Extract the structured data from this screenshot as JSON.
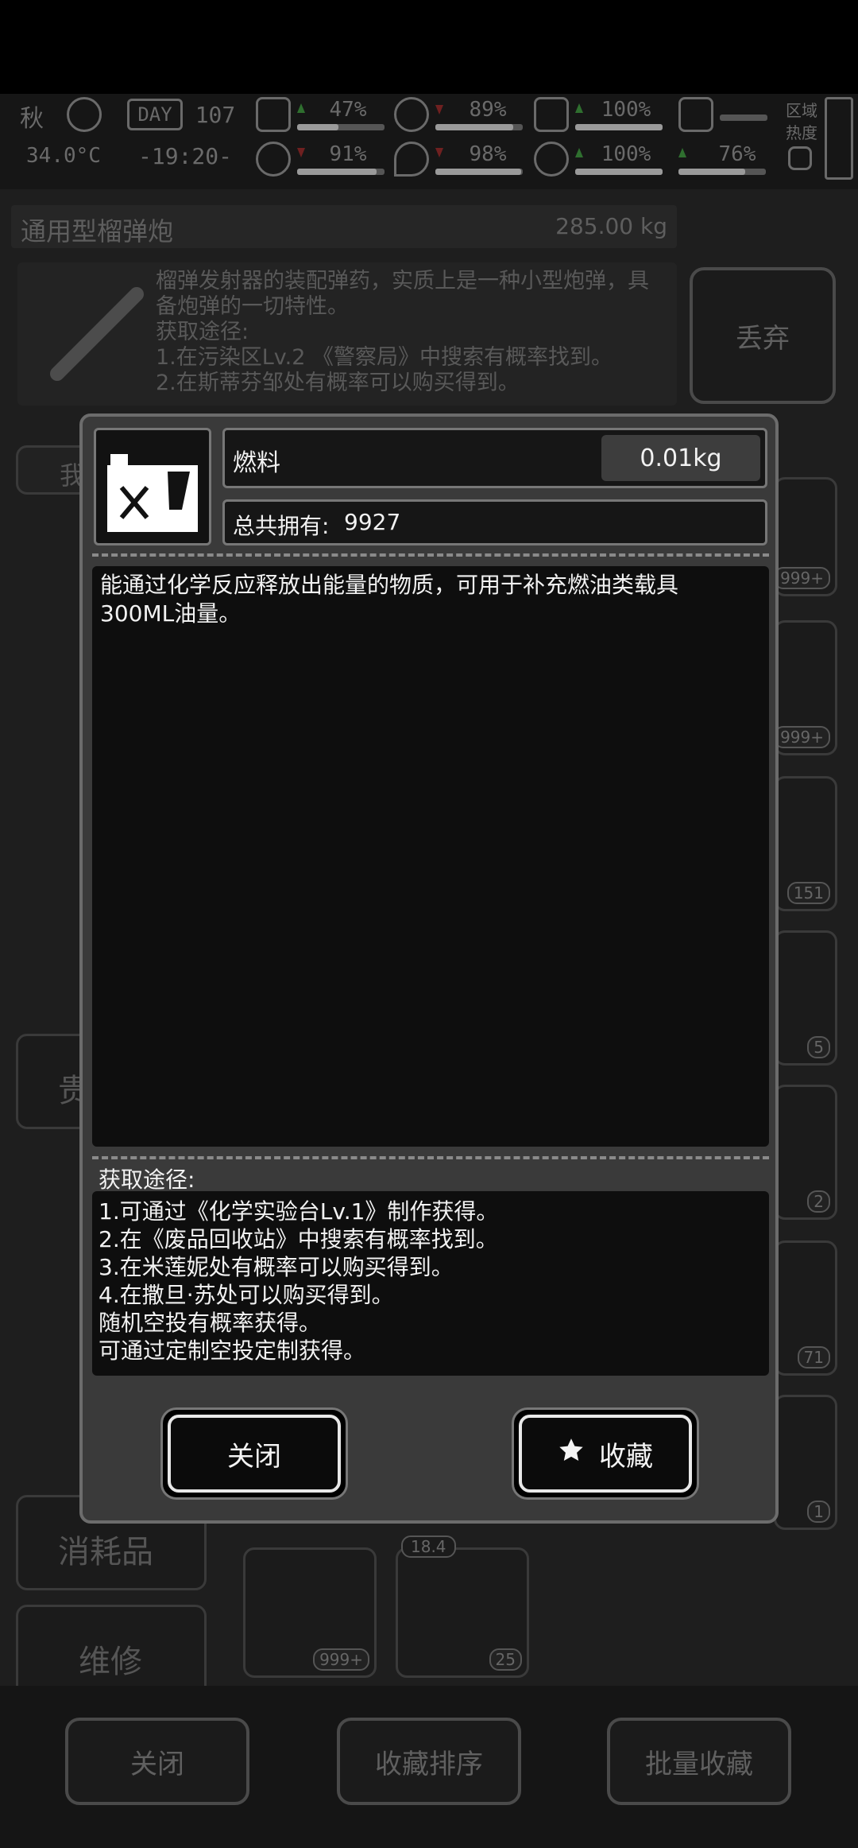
{
  "status_bar": {
    "season": "秋",
    "temperature": "34.0°C",
    "day_label": "DAY",
    "day_number": "107",
    "time": "-19:20-",
    "stats_row1": [
      "47%",
      "89%",
      "100%"
    ],
    "stats_row2": [
      "91%",
      "98%",
      "100%",
      "76%"
    ],
    "zone_heat_label_1": "区域",
    "zone_heat_label_2": "热度"
  },
  "background": {
    "item_name": "通用型榴弹炮",
    "item_weight": "285.00 kg",
    "item_description": "榴弹发射器的装配弹药，实质上是一种小型炮弹，具备炮弹的一切特性。\n获取途径:\n1.在污染区Lv.2 《警察局》中搜索有概率找到。\n2.在斯蒂芬邹处有概率可以购买得到。",
    "discard_button": "丢弃",
    "side_tab_partial_1": "我",
    "side_tab_partial_2": "贵",
    "side_tab_consumables": "消耗品",
    "side_tab_repair": "维修",
    "slot_counts": [
      "999+",
      "999+",
      "151",
      "5",
      "2",
      "71",
      "1"
    ],
    "bottom_item_1_count": "999+",
    "bottom_item_2_top": "18.4",
    "bottom_item_2_count": "25",
    "bottom_close": "关闭",
    "bottom_sort": "收藏排序",
    "bottom_batch": "批量收藏"
  },
  "modal": {
    "item_name": "燃料",
    "weight": "0.01kg",
    "total_label": "总共拥有:",
    "total_value": "9927",
    "description_line1": "能通过化学反应释放出能量的物质，可用于补充燃油类载具",
    "description_line2": "300ML油量。",
    "acquire_label": "获取途径:",
    "acquire_lines": [
      "1.可通过《化学实验台Lv.1》制作获得。",
      "2.在《废品回收站》中搜索有概率找到。",
      "3.在米莲妮处有概率可以购买得到。",
      "4.在撒旦·苏处可以购买得到。",
      "随机空投有概率获得。",
      "可通过定制空投定制获得。"
    ],
    "close_button": "关闭",
    "favorite_button": "收藏",
    "icons": {
      "item": "fuel-can-icon",
      "favorite": "star-icon"
    }
  }
}
